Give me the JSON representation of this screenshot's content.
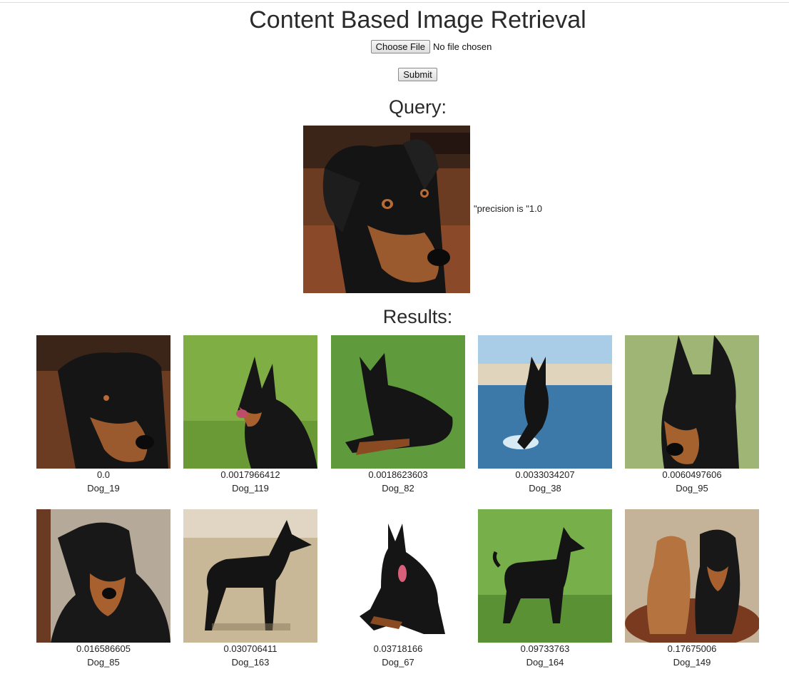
{
  "page": {
    "title": "Content Based Image Retrieval",
    "choose_file_label": "Choose File",
    "file_status": "No file chosen",
    "submit_label": "Submit",
    "query_heading": "Query:",
    "precision_text": "\"precision is \"1.0",
    "results_heading": "Results:"
  },
  "results": [
    {
      "score": "0.0",
      "name": "Dog_19"
    },
    {
      "score": "0.0017966412",
      "name": "Dog_119"
    },
    {
      "score": "0.0018623603",
      "name": "Dog_82"
    },
    {
      "score": "0.0033034207",
      "name": "Dog_38"
    },
    {
      "score": "0.0060497606",
      "name": "Dog_95"
    },
    {
      "score": "0.016586605",
      "name": "Dog_85"
    },
    {
      "score": "0.030706411",
      "name": "Dog_163"
    },
    {
      "score": "0.03718166",
      "name": "Dog_67"
    },
    {
      "score": "0.09733763",
      "name": "Dog_164"
    },
    {
      "score": "0.17675006",
      "name": "Dog_149"
    }
  ]
}
